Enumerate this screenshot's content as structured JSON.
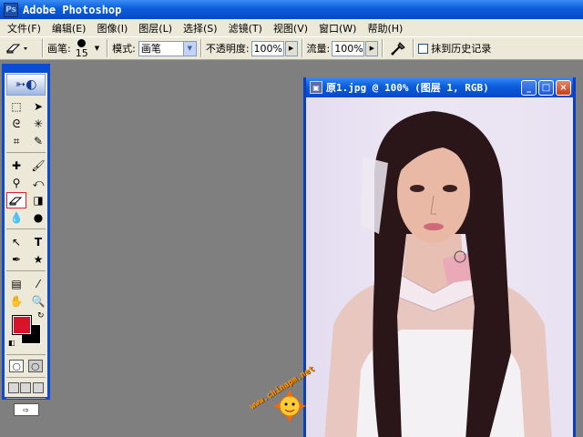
{
  "app": {
    "title": "Adobe Photoshop"
  },
  "menu": [
    "文件(F)",
    "编辑(E)",
    "图像(I)",
    "图层(L)",
    "选择(S)",
    "滤镜(T)",
    "视图(V)",
    "窗口(W)",
    "帮助(H)"
  ],
  "options": {
    "brush_label": "画笔:",
    "brush_size": "15",
    "mode_label": "模式:",
    "mode_value": "画笔",
    "opacity_label": "不透明度:",
    "opacity_value": "100%",
    "flow_label": "流量:",
    "flow_value": "100%",
    "history_label": "抹到历史记录"
  },
  "tools": {
    "selected": "eraser",
    "foreground_color": "#d9142a",
    "background_color": "#000000"
  },
  "document": {
    "title": "原1.jpg @ 100% (图层 1, RGB)",
    "min_label": "_",
    "max_label": "□",
    "close_label": "×"
  },
  "watermark": {
    "text": "www.chinapm.net"
  }
}
